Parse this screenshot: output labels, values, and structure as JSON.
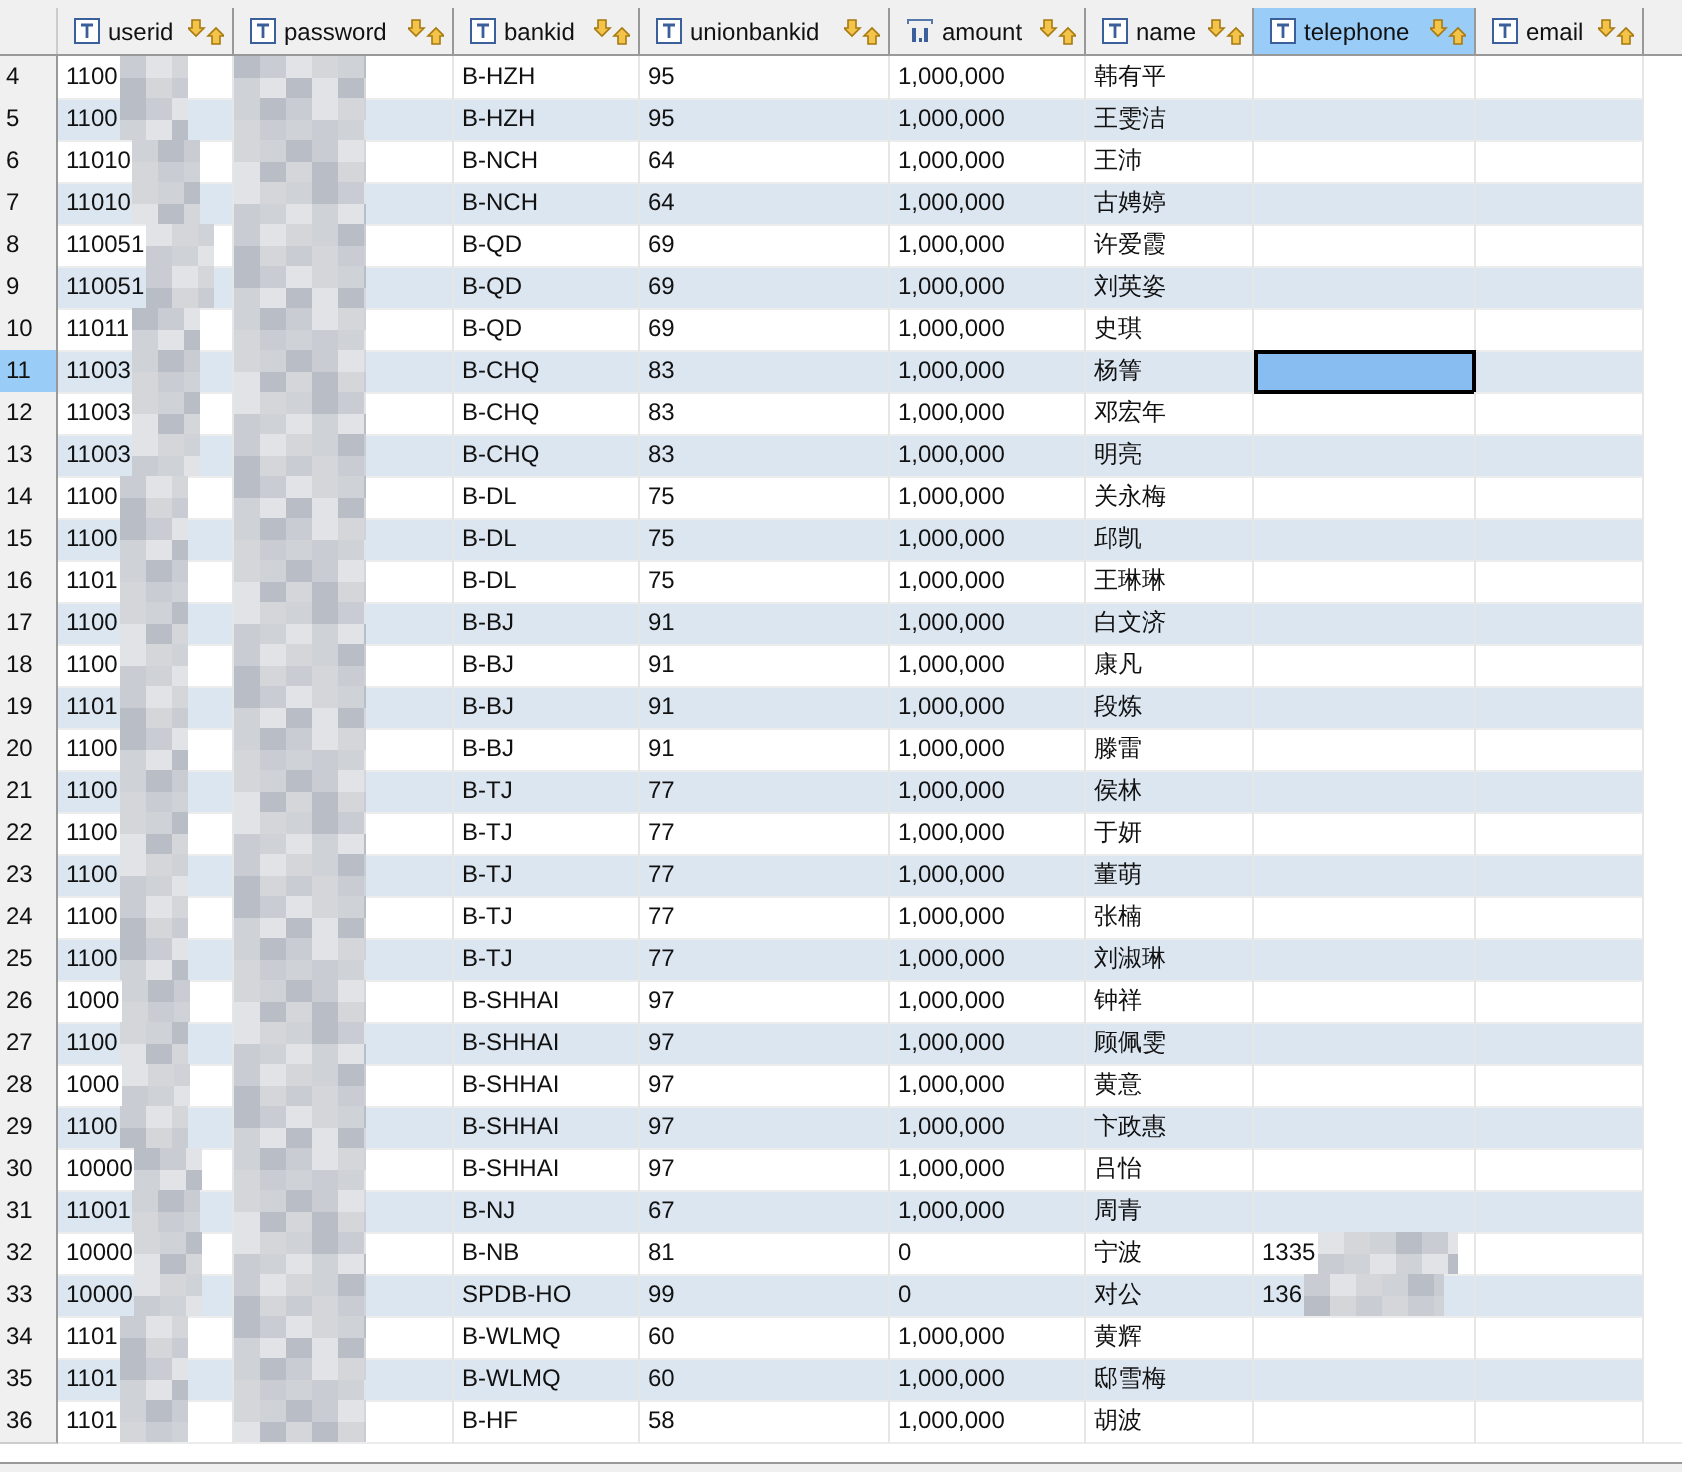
{
  "table": {
    "columns": [
      {
        "label": "userid",
        "kind": "text",
        "selected": false
      },
      {
        "label": "password",
        "kind": "text",
        "selected": false
      },
      {
        "label": "bankid",
        "kind": "text",
        "selected": false
      },
      {
        "label": "unionbankid",
        "kind": "text",
        "selected": false
      },
      {
        "label": "amount",
        "kind": "numeric",
        "selected": false
      },
      {
        "label": "name",
        "kind": "text",
        "selected": false
      },
      {
        "label": "telephone",
        "kind": "text",
        "selected": true
      },
      {
        "label": "email",
        "kind": "text",
        "selected": false
      }
    ],
    "rows": [
      {
        "number": "4",
        "selected": false,
        "cells": [
          "1100",
          "",
          "B-HZH",
          "95",
          "1,000,000",
          "韩有平",
          "",
          ""
        ]
      },
      {
        "number": "5",
        "selected": false,
        "cells": [
          "1100",
          "",
          "B-HZH",
          "95",
          "1,000,000",
          "王雯洁",
          "",
          ""
        ]
      },
      {
        "number": "6",
        "selected": false,
        "cells": [
          "11010",
          "",
          "B-NCH",
          "64",
          "1,000,000",
          "王沛",
          "",
          ""
        ]
      },
      {
        "number": "7",
        "selected": false,
        "cells": [
          "11010",
          "",
          "B-NCH",
          "64",
          "1,000,000",
          "古娉婷",
          "",
          ""
        ]
      },
      {
        "number": "8",
        "selected": false,
        "cells": [
          "110051",
          "",
          "B-QD",
          "69",
          "1,000,000",
          "许爱霞",
          "",
          ""
        ]
      },
      {
        "number": "9",
        "selected": false,
        "cells": [
          "110051",
          "",
          "B-QD",
          "69",
          "1,000,000",
          "刘英姿",
          "",
          ""
        ]
      },
      {
        "number": "10",
        "selected": false,
        "cells": [
          "11011",
          "",
          "B-QD",
          "69",
          "1,000,000",
          "史琪",
          "",
          ""
        ]
      },
      {
        "number": "11",
        "selected": true,
        "cells": [
          "11003",
          "",
          "B-CHQ",
          "83",
          "1,000,000",
          "杨箐",
          "",
          ""
        ]
      },
      {
        "number": "12",
        "selected": false,
        "cells": [
          "11003",
          "",
          "B-CHQ",
          "83",
          "1,000,000",
          "邓宏年",
          "",
          ""
        ]
      },
      {
        "number": "13",
        "selected": false,
        "cells": [
          "11003",
          "",
          "B-CHQ",
          "83",
          "1,000,000",
          "明亮",
          "",
          ""
        ]
      },
      {
        "number": "14",
        "selected": false,
        "cells": [
          "1100",
          "",
          "B-DL",
          "75",
          "1,000,000",
          "关永梅",
          "",
          ""
        ]
      },
      {
        "number": "15",
        "selected": false,
        "cells": [
          "1100",
          "",
          "B-DL",
          "75",
          "1,000,000",
          "邱凯",
          "",
          ""
        ]
      },
      {
        "number": "16",
        "selected": false,
        "cells": [
          "1101",
          "",
          "B-DL",
          "75",
          "1,000,000",
          "王琳琳",
          "",
          ""
        ]
      },
      {
        "number": "17",
        "selected": false,
        "cells": [
          "1100",
          "",
          "B-BJ",
          "91",
          "1,000,000",
          "白文济",
          "",
          ""
        ]
      },
      {
        "number": "18",
        "selected": false,
        "cells": [
          "1100",
          "",
          "B-BJ",
          "91",
          "1,000,000",
          "康凡",
          "",
          ""
        ]
      },
      {
        "number": "19",
        "selected": false,
        "cells": [
          "1101",
          "",
          "B-BJ",
          "91",
          "1,000,000",
          "段炼",
          "",
          ""
        ]
      },
      {
        "number": "20",
        "selected": false,
        "cells": [
          "1100",
          "",
          "B-BJ",
          "91",
          "1,000,000",
          "滕雷",
          "",
          ""
        ]
      },
      {
        "number": "21",
        "selected": false,
        "cells": [
          "1100",
          "",
          "B-TJ",
          "77",
          "1,000,000",
          "侯林",
          "",
          ""
        ]
      },
      {
        "number": "22",
        "selected": false,
        "cells": [
          "1100",
          "",
          "B-TJ",
          "77",
          "1,000,000",
          "于妍",
          "",
          ""
        ]
      },
      {
        "number": "23",
        "selected": false,
        "cells": [
          "1100",
          "",
          "B-TJ",
          "77",
          "1,000,000",
          "董萌",
          "",
          ""
        ]
      },
      {
        "number": "24",
        "selected": false,
        "cells": [
          "1100",
          "",
          "B-TJ",
          "77",
          "1,000,000",
          "张楠",
          "",
          ""
        ]
      },
      {
        "number": "25",
        "selected": false,
        "cells": [
          "1100",
          "",
          "B-TJ",
          "77",
          "1,000,000",
          "刘淑琳",
          "",
          ""
        ]
      },
      {
        "number": "26",
        "selected": false,
        "cells": [
          "1000",
          "",
          "B-SHHAI",
          "97",
          "1,000,000",
          "钟祥",
          "",
          ""
        ]
      },
      {
        "number": "27",
        "selected": false,
        "cells": [
          "1100",
          "",
          "B-SHHAI",
          "97",
          "1,000,000",
          "顾佩雯",
          "",
          ""
        ]
      },
      {
        "number": "28",
        "selected": false,
        "cells": [
          "1000",
          "",
          "B-SHHAI",
          "97",
          "1,000,000",
          "黄意",
          "",
          ""
        ]
      },
      {
        "number": "29",
        "selected": false,
        "cells": [
          "1100",
          "",
          "B-SHHAI",
          "97",
          "1,000,000",
          "卞政惠",
          "",
          ""
        ]
      },
      {
        "number": "30",
        "selected": false,
        "cells": [
          "10000",
          "",
          "B-SHHAI",
          "97",
          "1,000,000",
          "吕怡",
          "",
          ""
        ]
      },
      {
        "number": "31",
        "selected": false,
        "cells": [
          "11001",
          "",
          "B-NJ",
          "67",
          "1,000,000",
          "周青",
          "",
          ""
        ]
      },
      {
        "number": "32",
        "selected": false,
        "cells": [
          "10000",
          "",
          "B-NB",
          "81",
          "0",
          "宁波",
          "1335",
          ""
        ]
      },
      {
        "number": "33",
        "selected": false,
        "cells": [
          "10000",
          "",
          "SPDB-HO",
          "99",
          "0",
          "对公",
          "136",
          ""
        ]
      },
      {
        "number": "34",
        "selected": false,
        "cells": [
          "1101",
          "",
          "B-WLMQ",
          "60",
          "1,000,000",
          "黄辉",
          "",
          ""
        ]
      },
      {
        "number": "35",
        "selected": false,
        "cells": [
          "1101",
          "",
          "B-WLMQ",
          "60",
          "1,000,000",
          "邸雪梅",
          "",
          ""
        ]
      },
      {
        "number": "36",
        "selected": false,
        "cells": [
          "1101",
          "",
          "B-HF",
          "58",
          "1,000,000",
          "胡波",
          "",
          ""
        ]
      }
    ]
  }
}
